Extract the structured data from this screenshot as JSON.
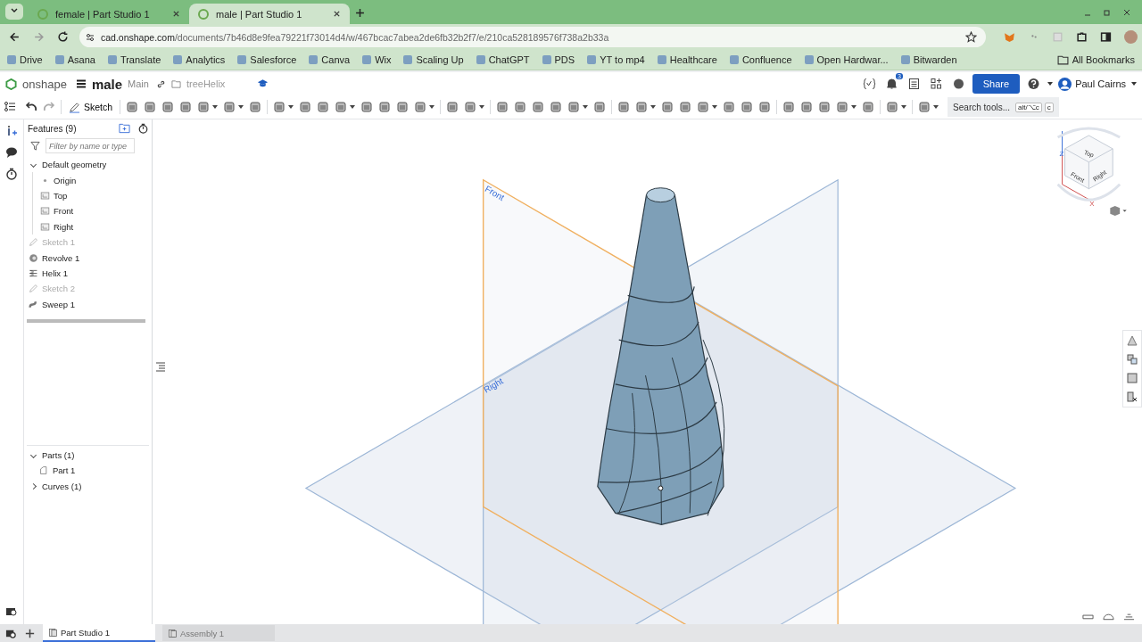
{
  "browser": {
    "tabs": [
      {
        "title": "female | Part Studio 1",
        "selected": false
      },
      {
        "title": "male | Part Studio 1",
        "selected": true
      }
    ],
    "url": {
      "host": "cad.onshape.com",
      "path": "/documents/7b46d8e9fea79221f73014d4/w/467bcac7abea2de6fb32b2f7/e/210ca528189576f738a2b33a"
    },
    "bookmarks": [
      "Drive",
      "Asana",
      "Translate",
      "Analytics",
      "Salesforce",
      "Canva",
      "Wix",
      "Scaling Up",
      "ChatGPT",
      "PDS",
      "YT to mp4",
      "Healthcare",
      "Confluence",
      "Open Hardwar...",
      "Bitwarden"
    ],
    "all_bookmarks": "All Bookmarks"
  },
  "app": {
    "logo": "onshape",
    "document": "male",
    "branch": "Main",
    "folder": "treeHelix",
    "notifications": "3",
    "share": "Share",
    "user": "Paul Cairns"
  },
  "toolbar": {
    "sketch": "Sketch",
    "search": "Search tools...",
    "shortcut": "alt/⌥c",
    "shortcut_key": "c"
  },
  "features": {
    "title": "Features (9)",
    "filter_placeholder": "Filter by name or type",
    "items": [
      {
        "label": "Default geometry",
        "kind": "group",
        "expanded": true,
        "children": [
          {
            "label": "Origin",
            "kind": "point",
            "disabled": false
          },
          {
            "label": "Top",
            "kind": "plane",
            "disabled": false
          },
          {
            "label": "Front",
            "kind": "plane",
            "disabled": false
          },
          {
            "label": "Right",
            "kind": "plane",
            "disabled": false
          }
        ]
      },
      {
        "label": "Sketch 1",
        "kind": "sketch",
        "disabled": true
      },
      {
        "label": "Revolve 1",
        "kind": "revolve",
        "disabled": false
      },
      {
        "label": "Helix 1",
        "kind": "helix",
        "disabled": false
      },
      {
        "label": "Sketch 2",
        "kind": "sketch",
        "disabled": true
      },
      {
        "label": "Sweep 1",
        "kind": "sweep",
        "disabled": false
      }
    ]
  },
  "parts": [
    {
      "label": "Parts (1)",
      "expanded": true,
      "children": [
        {
          "label": "Part 1"
        }
      ]
    },
    {
      "label": "Curves (1)",
      "expanded": false
    }
  ],
  "viewport": {
    "plane_labels": [
      "Front",
      "Right"
    ],
    "cube": {
      "top": "Top",
      "front": "Front",
      "right": "Right",
      "z": "Z",
      "x": "X"
    }
  },
  "bottom_tabs": [
    {
      "label": "Part Studio 1",
      "selected": true
    },
    {
      "label": "Assembly 1",
      "selected": false
    }
  ]
}
